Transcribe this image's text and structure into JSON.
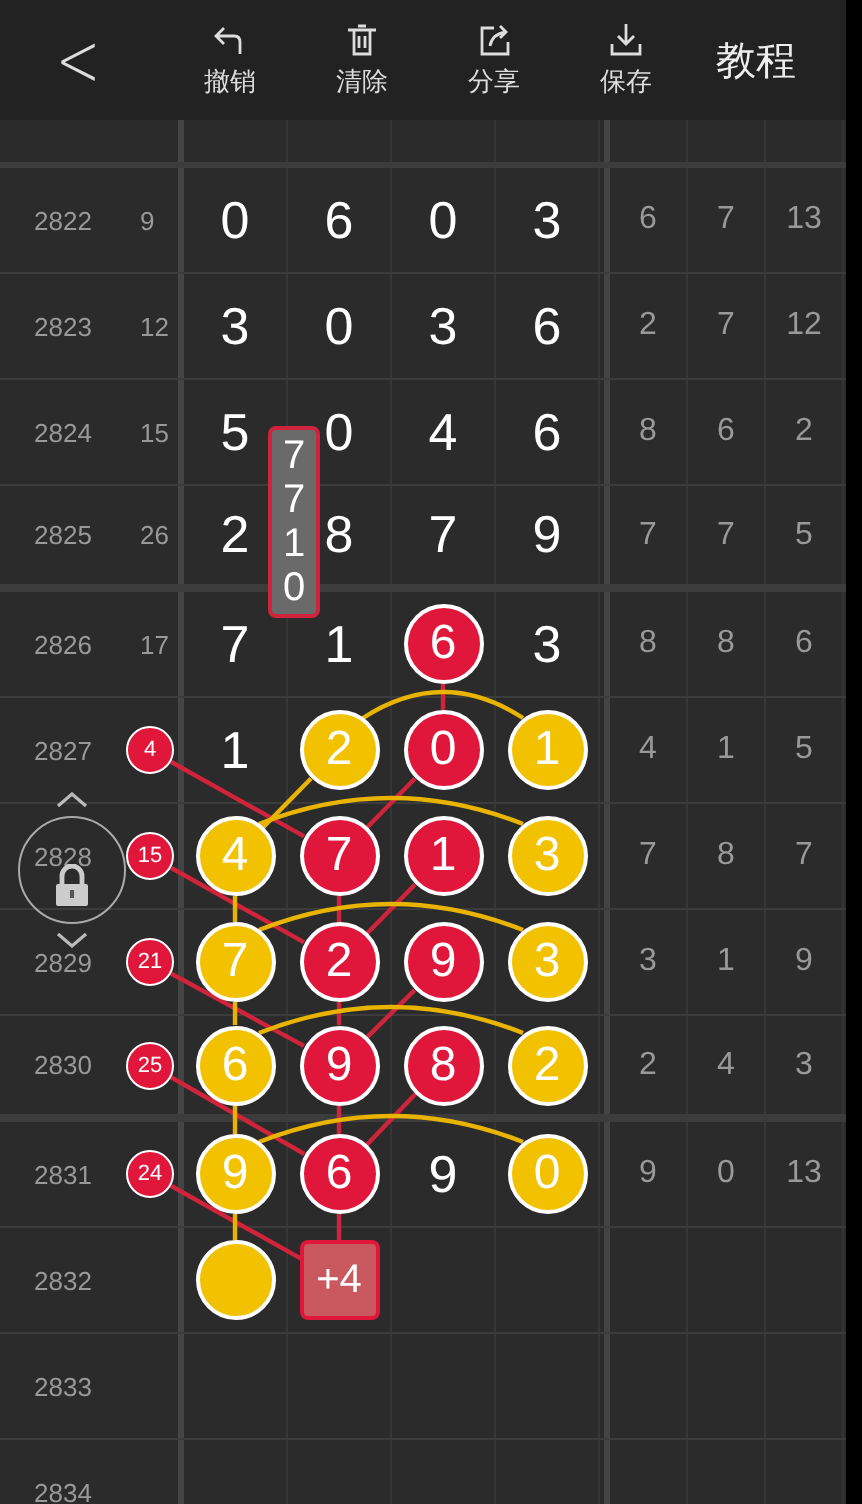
{
  "header": {
    "back": "<",
    "actions": [
      {
        "kind": "undo",
        "label": "撤销"
      },
      {
        "kind": "clear",
        "label": "清除"
      },
      {
        "kind": "share",
        "label": "分享"
      },
      {
        "kind": "save",
        "label": "保存"
      }
    ],
    "tutorial": "教程"
  },
  "rows": [
    {
      "issue": "2822",
      "count": "9",
      "cells": [
        {
          "kind": "plain",
          "text": "0"
        },
        {
          "kind": "plain",
          "text": "6"
        },
        {
          "kind": "plain",
          "text": "0"
        },
        {
          "kind": "plain",
          "text": "3"
        }
      ],
      "stats": [
        "6",
        "7",
        "13"
      ]
    },
    {
      "issue": "2823",
      "count": "12",
      "cells": [
        {
          "kind": "plain",
          "text": "3"
        },
        {
          "kind": "plain",
          "text": "0"
        },
        {
          "kind": "plain",
          "text": "3"
        },
        {
          "kind": "plain",
          "text": "6"
        }
      ],
      "stats": [
        "2",
        "7",
        "12"
      ]
    },
    {
      "issue": "2824",
      "count": "15",
      "cells": [
        {
          "kind": "plain",
          "text": "5"
        },
        {
          "kind": "plain",
          "text": "0"
        },
        {
          "kind": "plain",
          "text": "4"
        },
        {
          "kind": "plain",
          "text": "6"
        }
      ],
      "stats": [
        "8",
        "6",
        "2"
      ]
    },
    {
      "issue": "2825",
      "count": "26",
      "cells": [
        {
          "kind": "plain",
          "text": "2"
        },
        {
          "kind": "plain",
          "text": "8"
        },
        {
          "kind": "plain",
          "text": "7"
        },
        {
          "kind": "plain",
          "text": "9"
        }
      ],
      "stats": [
        "7",
        "7",
        "5"
      ]
    },
    {
      "issue": "2826",
      "count": "17",
      "cells": [
        {
          "kind": "plain",
          "text": "7"
        },
        {
          "kind": "plain",
          "text": "1"
        },
        {
          "kind": "red",
          "text": "6"
        },
        {
          "kind": "plain",
          "text": "3"
        }
      ],
      "stats": [
        "8",
        "8",
        "6"
      ]
    },
    {
      "issue": "2827",
      "badge": "4",
      "cells": [
        {
          "kind": "plain",
          "text": "1"
        },
        {
          "kind": "yellow",
          "text": "2"
        },
        {
          "kind": "red",
          "text": "0"
        },
        {
          "kind": "yellow",
          "text": "1"
        }
      ],
      "stats": [
        "4",
        "1",
        "5"
      ]
    },
    {
      "issue": "2828",
      "badge": "15",
      "cells": [
        {
          "kind": "yellow",
          "text": "4"
        },
        {
          "kind": "red",
          "text": "7"
        },
        {
          "kind": "red",
          "text": "1"
        },
        {
          "kind": "yellow",
          "text": "3"
        }
      ],
      "stats": [
        "7",
        "8",
        "7"
      ]
    },
    {
      "issue": "2829",
      "badge": "21",
      "cells": [
        {
          "kind": "yellow",
          "text": "7"
        },
        {
          "kind": "red",
          "text": "2"
        },
        {
          "kind": "red",
          "text": "9"
        },
        {
          "kind": "yellow",
          "text": "3"
        }
      ],
      "stats": [
        "3",
        "1",
        "9"
      ]
    },
    {
      "issue": "2830",
      "badge": "25",
      "cells": [
        {
          "kind": "yellow",
          "text": "6"
        },
        {
          "kind": "red",
          "text": "9"
        },
        {
          "kind": "red",
          "text": "8"
        },
        {
          "kind": "yellow",
          "text": "2"
        }
      ],
      "stats": [
        "2",
        "4",
        "3"
      ]
    },
    {
      "issue": "2831",
      "badge": "24",
      "cells": [
        {
          "kind": "yellow",
          "text": "9"
        },
        {
          "kind": "red",
          "text": "6"
        },
        {
          "kind": "plain",
          "text": "9"
        },
        {
          "kind": "yellow",
          "text": "0"
        }
      ],
      "stats": [
        "9",
        "0",
        "13"
      ]
    },
    {
      "issue": "2832",
      "cells": [
        {
          "kind": "yellow"
        },
        {
          "kind": "box",
          "text": "+4"
        },
        {
          "kind": "empty"
        },
        {
          "kind": "empty"
        }
      ]
    },
    {
      "issue": "2833",
      "cells": [
        {
          "kind": "empty"
        },
        {
          "kind": "empty"
        },
        {
          "kind": "empty"
        },
        {
          "kind": "empty"
        }
      ]
    },
    {
      "issue": "2834",
      "cells": [
        {
          "kind": "empty"
        },
        {
          "kind": "empty"
        },
        {
          "kind": "empty"
        },
        {
          "kind": "empty"
        }
      ]
    }
  ],
  "marker": {
    "digits": "7710"
  }
}
